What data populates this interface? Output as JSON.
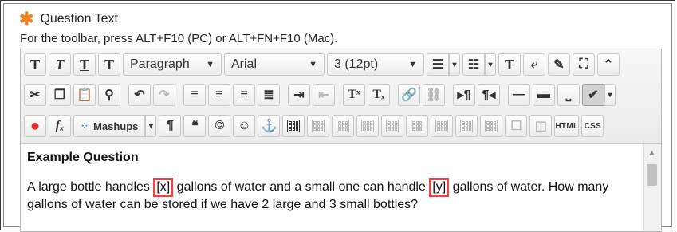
{
  "question": {
    "required_icon": "asterisk-icon",
    "label": "Question Text",
    "hint": "For the toolbar, press ALT+F10 (PC) or ALT+FN+F10 (Mac)."
  },
  "toolbar": {
    "paragraph_select": "Paragraph",
    "font_select": "Arial",
    "size_select": "3 (12pt)",
    "mashups_label": "Mashups",
    "html_label": "HTML",
    "css_label": "CSS",
    "caret": "▼"
  },
  "content": {
    "heading": "Example Question",
    "text_1": "A large bottle handles ",
    "blank_x": "[x]",
    "text_2": " gallons of water and a small one can handle ",
    "blank_y": "[y]",
    "text_3": " gallons of water. How many gallons of water can be stored if we have 2 large and 3 small bottles?"
  },
  "colors": {
    "required": "#f0821e",
    "blank_border": "#e04a4a",
    "mashups_dots": "#1b72c9",
    "youtube": "#e0332a"
  }
}
